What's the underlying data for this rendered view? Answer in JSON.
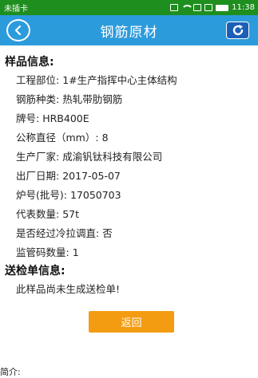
{
  "status_bar": {
    "carrier": "未插卡",
    "time": "11:38"
  },
  "header": {
    "title": "钢筋原材"
  },
  "sample_info": {
    "section_title": "样品信息:",
    "fields": [
      {
        "label": "工程部位:",
        "value": "1#生产指挥中心主体结构"
      },
      {
        "label": "钢筋种类:",
        "value": "热轧带肋钢筋"
      },
      {
        "label": "牌号:",
        "value": "HRB400E"
      },
      {
        "label": "公称直径（mm）:",
        "value": "8"
      },
      {
        "label": "生产厂家:",
        "value": "成渝钒钛科技有限公司"
      },
      {
        "label": "出厂日期:",
        "value": "2017-05-07"
      },
      {
        "label": "炉号(批号):",
        "value": "17050703"
      },
      {
        "label": "代表数量:",
        "value": "57t"
      },
      {
        "label": "是否经过冷拉调直:",
        "value": "否"
      },
      {
        "label": "监管码数量:",
        "value": "1"
      }
    ]
  },
  "inspection_info": {
    "section_title": "送检单信息:",
    "message": "此样品尚未生成送检单!"
  },
  "return_button": {
    "label": "返回"
  },
  "footer_fragment": "简介:"
}
